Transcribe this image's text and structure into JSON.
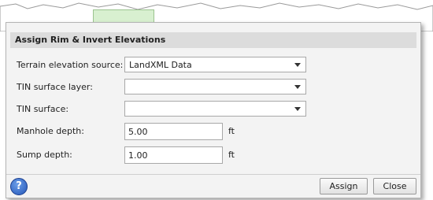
{
  "dialog": {
    "section_title": "Assign Rim & Invert Elevations",
    "fields": {
      "terrain_source": {
        "label": "Terrain elevation source:",
        "value": "LandXML Data"
      },
      "tin_layer": {
        "label": "TIN surface layer:",
        "value": ""
      },
      "tin_surface": {
        "label": "TIN surface:",
        "value": ""
      },
      "manhole_depth": {
        "label": "Manhole depth:",
        "value": "5.00",
        "unit": "ft"
      },
      "sump_depth": {
        "label": "Sump depth:",
        "value": "1.00",
        "unit": "ft"
      }
    },
    "footer": {
      "help_symbol": "?",
      "assign_label": "Assign",
      "close_label": "Close"
    }
  }
}
